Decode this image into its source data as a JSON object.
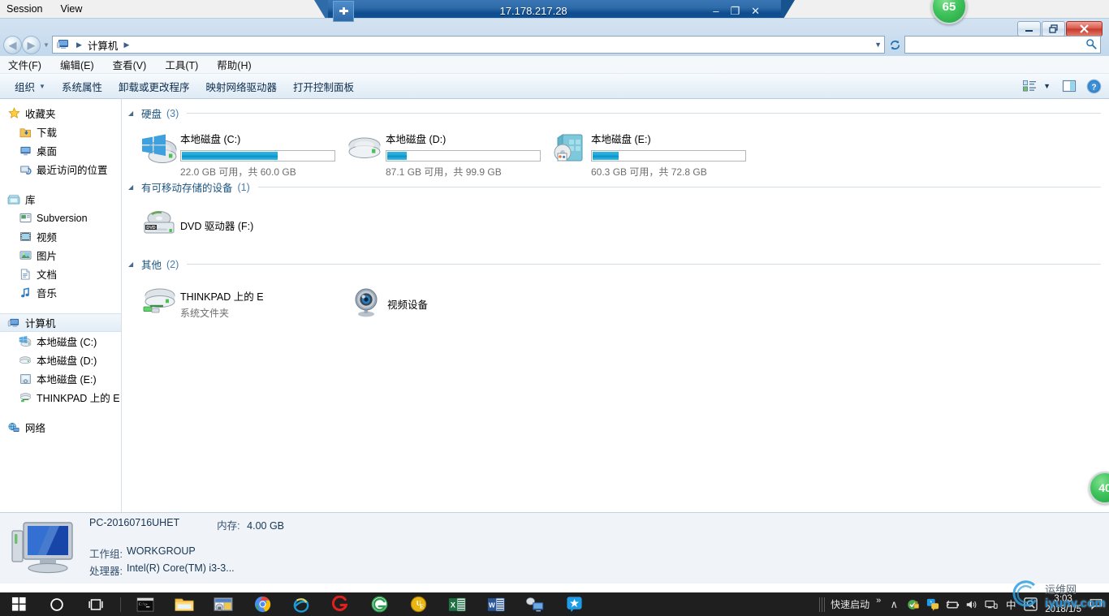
{
  "session_strip": {
    "items": [
      {
        "label": "Session",
        "name": "session-menu"
      },
      {
        "label": "View",
        "name": "view-menu"
      }
    ]
  },
  "rdp_bar": {
    "title": "17.178.217.28",
    "pin_icon": "pin-icon",
    "minimize": "–",
    "restore": "❐",
    "close": "✕"
  },
  "window": {
    "minimize": "–",
    "restore": "❐",
    "close": "✕"
  },
  "address_bar": {
    "back_glyph": "◀",
    "forward_glyph": "▶",
    "history_glyph": "▼",
    "computer_icon": "computer-icon",
    "crumb": "计算机",
    "sep1": "▶",
    "sep2": "▶",
    "dropdown_glyph": "▼",
    "refresh_glyph": "↻"
  },
  "search": {
    "value": "",
    "placeholder": "",
    "icon": "search-icon"
  },
  "menubar": {
    "items": [
      {
        "label": "文件(F)",
        "name": "menu-file"
      },
      {
        "label": "编辑(E)",
        "name": "menu-edit"
      },
      {
        "label": "查看(V)",
        "name": "menu-view"
      },
      {
        "label": "工具(T)",
        "name": "menu-tools"
      },
      {
        "label": "帮助(H)",
        "name": "menu-help"
      }
    ]
  },
  "commandbar": {
    "items": [
      {
        "label": "组织",
        "name": "cmd-organize",
        "caret": "▼"
      },
      {
        "label": "系统属性",
        "name": "cmd-system-properties",
        "caret": ""
      },
      {
        "label": "卸载或更改程序",
        "name": "cmd-uninstall-change-program",
        "caret": ""
      },
      {
        "label": "映射网络驱动器",
        "name": "cmd-map-network-drive",
        "caret": ""
      },
      {
        "label": "打开控制面板",
        "name": "cmd-open-control-panel",
        "caret": ""
      }
    ],
    "view_icon": "view-options-icon",
    "view_caret": "▼",
    "preview_icon": "preview-pane-icon",
    "help_icon": "help-icon"
  },
  "navpane": {
    "groups": [
      {
        "header": {
          "label": "收藏夹",
          "icon": "star-icon",
          "name": "nav-favorites"
        },
        "items": [
          {
            "label": "下载",
            "icon": "downloads-icon",
            "name": "nav-downloads"
          },
          {
            "label": "桌面",
            "icon": "desktop-icon",
            "name": "nav-desktop"
          },
          {
            "label": "最近访问的位置",
            "icon": "recent-places-icon",
            "name": "nav-recent-places"
          }
        ]
      },
      {
        "header": {
          "label": "库",
          "icon": "library-icon",
          "name": "nav-libraries"
        },
        "items": [
          {
            "label": "Subversion",
            "icon": "subversion-icon",
            "name": "nav-subversion"
          },
          {
            "label": "视频",
            "icon": "videos-icon",
            "name": "nav-videos"
          },
          {
            "label": "图片",
            "icon": "pictures-icon",
            "name": "nav-pictures"
          },
          {
            "label": "文档",
            "icon": "documents-icon",
            "name": "nav-documents"
          },
          {
            "label": "音乐",
            "icon": "music-icon",
            "name": "nav-music"
          }
        ]
      },
      {
        "header": {
          "label": "计算机",
          "icon": "computer-icon",
          "name": "nav-computer",
          "selected": true
        },
        "items": [
          {
            "label": "本地磁盘 (C:)",
            "icon": "windows-drive-icon",
            "name": "nav-drive-c"
          },
          {
            "label": "本地磁盘 (D:)",
            "icon": "drive-icon",
            "name": "nav-drive-d"
          },
          {
            "label": "本地磁盘 (E:)",
            "icon": "drive-e-icon",
            "name": "nav-drive-e"
          },
          {
            "label": "THINKPAD 上的 E",
            "icon": "network-drive-icon",
            "name": "nav-thinkpad-e"
          }
        ]
      },
      {
        "header": {
          "label": "网络",
          "icon": "network-icon",
          "name": "nav-network"
        },
        "items": []
      }
    ]
  },
  "content": {
    "groups": [
      {
        "name": "group-hard-disks",
        "title": "硬盘",
        "count": "(3)",
        "triangle": "◢",
        "items": [
          {
            "name": "drive-c",
            "label": "本地磁盘 (C:)",
            "icon": "windows-drive-icon",
            "free_text": "22.0 GB 可用，共 60.0 GB",
            "free_gb": 22.0,
            "total_gb": 60.0,
            "used_percent": 63
          },
          {
            "name": "drive-d",
            "label": "本地磁盘 (D:)",
            "icon": "drive-icon",
            "free_text": "87.1 GB 可用，共 99.9 GB",
            "free_gb": 87.1,
            "total_gb": 99.9,
            "used_percent": 13
          },
          {
            "name": "drive-e",
            "label": "本地磁盘 (E:)",
            "icon": "drive-e-icon",
            "free_text": "60.3 GB 可用，共 72.8 GB",
            "free_gb": 60.3,
            "total_gb": 72.8,
            "used_percent": 17
          }
        ]
      },
      {
        "name": "group-removable",
        "title": "有可移动存储的设备",
        "count": "(1)",
        "triangle": "◢",
        "items": [
          {
            "name": "dvd-drive-f",
            "label": "DVD 驱动器 (F:)",
            "icon": "dvd-drive-icon",
            "free_text": "",
            "used_percent": null
          }
        ]
      },
      {
        "name": "group-other",
        "title": "其他",
        "count": "(2)",
        "triangle": "◢",
        "items": [
          {
            "name": "thinkpad-e",
            "label": "THINKPAD 上的 E",
            "icon": "network-drive-icon",
            "sub": "系统文件夹",
            "used_percent": null
          },
          {
            "name": "video-device",
            "label": "视频设备",
            "icon": "webcam-icon",
            "sub": "",
            "used_percent": null
          }
        ]
      }
    ]
  },
  "details_pane": {
    "icon": "computer-large-icon",
    "computer_name": "PC-20160716UHET",
    "memory_key": "内存:",
    "memory_value": "4.00 GB",
    "workgroup_key": "工作组:",
    "workgroup_value": "WORKGROUP",
    "processor_key": "处理器:",
    "processor_value": "Intel(R) Core(TM) i3-3..."
  },
  "taskbar": {
    "start_icon": "windows-start-icon",
    "search_icon": "cortana-search-icon",
    "taskview_icon": "task-view-icon",
    "pinned": [
      {
        "name": "command-prompt-icon",
        "label": "cmd"
      },
      {
        "name": "file-explorer-icon",
        "label": "Explorer"
      },
      {
        "name": "remote-desktop-icon",
        "label": "Remote Desktop"
      },
      {
        "name": "chrome-icon",
        "label": "Chrome"
      },
      {
        "name": "internet-explorer-icon",
        "label": "Internet Explorer"
      },
      {
        "name": "g-browser-icon",
        "label": "G"
      },
      {
        "name": "e-browser-icon",
        "label": "E"
      },
      {
        "name": "ultraedit-icon",
        "label": "UltraEdit"
      },
      {
        "name": "excel-icon",
        "label": "Excel"
      },
      {
        "name": "word-icon",
        "label": "Word"
      },
      {
        "name": "network-computer-icon",
        "label": "Network"
      },
      {
        "name": "star-app-icon",
        "label": "Star"
      }
    ],
    "tray": {
      "quick_launch_label": "快速启动",
      "overflow_glyph": "»",
      "chevron_glyph": "∧",
      "icons": [
        {
          "name": "security-shield-icon"
        },
        {
          "name": "input-method-icon"
        },
        {
          "name": "battery-icon"
        },
        {
          "name": "volume-icon"
        },
        {
          "name": "network-icon"
        },
        {
          "name": "ime-chinese-icon",
          "label": "中"
        },
        {
          "name": "search-tray-icon"
        }
      ],
      "clock_time": "3:03",
      "clock_date": "2018/1/5",
      "action_center_icon": "action-center-icon"
    }
  },
  "badges": [
    {
      "name": "badge-score-65",
      "value": "65"
    },
    {
      "name": "badge-score-40",
      "value": "40"
    }
  ],
  "watermark": {
    "logo": "swirl-logo",
    "cn_text": "运维网",
    "url_text": "iyunv.com"
  }
}
